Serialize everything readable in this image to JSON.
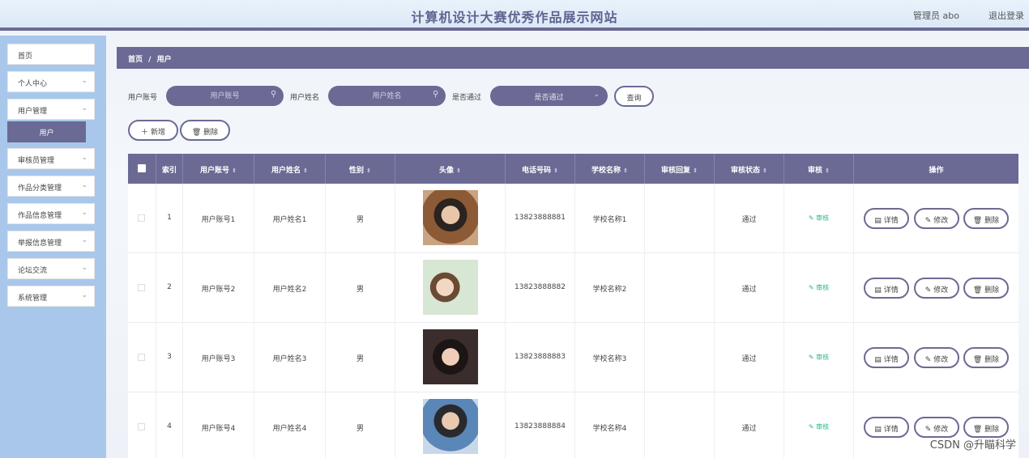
{
  "header": {
    "title": "计算机设计大赛优秀作品展示网站",
    "user_label": "管理员 abo",
    "logout_label": "退出登录"
  },
  "sidebar": {
    "items": [
      {
        "label": "首页",
        "has_children": false
      },
      {
        "label": "个人中心",
        "has_children": true
      },
      {
        "label": "用户管理",
        "has_children": true
      },
      {
        "label": "审核员管理",
        "has_children": true
      },
      {
        "label": "作品分类管理",
        "has_children": true
      },
      {
        "label": "作品信息管理",
        "has_children": true
      },
      {
        "label": "举报信息管理",
        "has_children": true
      },
      {
        "label": "论坛交流",
        "has_children": true
      },
      {
        "label": "系统管理",
        "has_children": true
      }
    ],
    "active_sub": "用户"
  },
  "breadcrumb": {
    "home": "首页",
    "sep": "/",
    "current": "用户"
  },
  "search": {
    "account_label": "用户账号",
    "account_placeholder": "用户账号",
    "name_label": "用户姓名",
    "name_placeholder": "用户姓名",
    "pass_label": "是否通过",
    "pass_placeholder": "是否通过",
    "query_label": "查询"
  },
  "actions": {
    "add_label": "新增",
    "delete_label": "删除"
  },
  "table": {
    "headers": {
      "index": "索引",
      "account": "用户账号",
      "name": "用户姓名",
      "gender": "性别",
      "avatar": "头像",
      "phone": "电话号码",
      "school": "学校名称",
      "reply": "审核回复",
      "status": "审核状态",
      "audit": "审核",
      "ops": "操作"
    },
    "audit_link": "审核",
    "op_labels": {
      "detail": "详情",
      "edit": "修改",
      "delete": "删除"
    },
    "rows": [
      {
        "index": "1",
        "account": "用户账号1",
        "name": "用户姓名1",
        "gender": "男",
        "phone": "13823888881",
        "school": "学校名称1",
        "reply": "",
        "status": "通过"
      },
      {
        "index": "2",
        "account": "用户账号2",
        "name": "用户姓名2",
        "gender": "男",
        "phone": "13823888882",
        "school": "学校名称2",
        "reply": "",
        "status": "通过"
      },
      {
        "index": "3",
        "account": "用户账号3",
        "name": "用户姓名3",
        "gender": "男",
        "phone": "13823888883",
        "school": "学校名称3",
        "reply": "",
        "status": "通过"
      },
      {
        "index": "4",
        "account": "用户账号4",
        "name": "用户姓名4",
        "gender": "男",
        "phone": "13823888884",
        "school": "学校名称4",
        "reply": "",
        "status": "通过"
      }
    ]
  },
  "watermark": "CSDN @升瞄科学",
  "colors": {
    "accent": "#6b6a94",
    "sidebar": "#a9c7eb",
    "audit_green": "#2bb38f"
  }
}
